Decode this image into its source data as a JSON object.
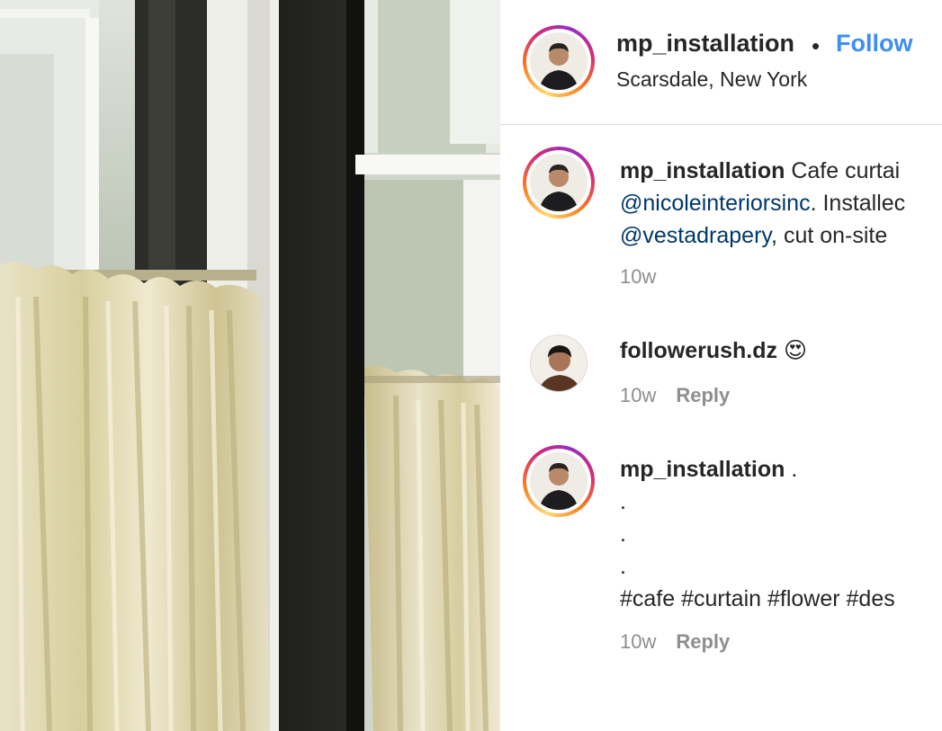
{
  "header": {
    "username": "mp_installation",
    "separator": "•",
    "follow_label": "Follow",
    "location": "Scarsdale, New York"
  },
  "comments": [
    {
      "username": "mp_installation",
      "text_line1": " Cafe curtai",
      "mention1": "@nicoleinteriorsinc",
      "text_line2_rest": ". Installec",
      "mention2": "@vestadrapery",
      "text_line3_rest": ", cut on-site",
      "time": "10w"
    },
    {
      "username": "followerush.dz",
      "emoji": "😍",
      "time": "10w",
      "reply_label": "Reply"
    },
    {
      "username": "mp_installation",
      "first_line_rest": " .",
      "dot_lines": [
        ".",
        ".",
        "."
      ],
      "hashtags": "#cafe #curtain #flower #des",
      "time": "10w",
      "reply_label": "Reply"
    }
  ],
  "colors": {
    "link": "#00376b",
    "follow": "#3d8ff0",
    "muted": "#8e8e8e",
    "text": "#262626"
  }
}
